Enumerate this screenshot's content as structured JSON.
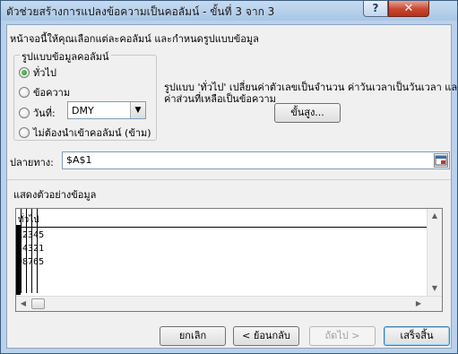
{
  "window": {
    "title": "ตัวช่วยสร้างการแปลงข้อความเป็นคอลัมน์ - ขั้นที่ 3 จาก 3",
    "help_label": "?",
    "close_label": "✕"
  },
  "intro_text": "หน้าจอนี้ให้คุณเลือกแต่ละคอลัมน์ และกำหนดรูปแบบข้อมูล",
  "column_format": {
    "legend": "รูปแบบข้อมูลคอลัมน์",
    "options": [
      {
        "label": "ทั่วไป",
        "checked": true
      },
      {
        "label": "ข้อความ",
        "checked": false
      },
      {
        "label": "วันที่:",
        "checked": false
      },
      {
        "label": "ไม่ต้องนำเข้าคอลัมน์ (ข้าม)",
        "checked": false
      }
    ],
    "date_value": "DMY"
  },
  "description": {
    "line1": "รูปแบบ 'ทั่วไป' เปลี่ยนค่าตัวเลขเป็นจำนวน ค่าวันเวลาเป็นวันเวลา และ",
    "line2": "ค่าส่วนที่เหลือเป็นข้อความ"
  },
  "advanced_label": "ขั้นสูง...",
  "destination": {
    "label": "ปลายทาง:",
    "value": "$A$1"
  },
  "preview": {
    "legend": "แสดงตัวอย่างข้อมูล",
    "header": "ทั่วไป",
    "rows": [
      "12345",
      "54321",
      "98765"
    ]
  },
  "buttons": {
    "cancel": "ยกเลิก",
    "back": "< ย้อนกลับ",
    "next": "ถัดไป >",
    "finish": "เสร็จสิ้น"
  }
}
